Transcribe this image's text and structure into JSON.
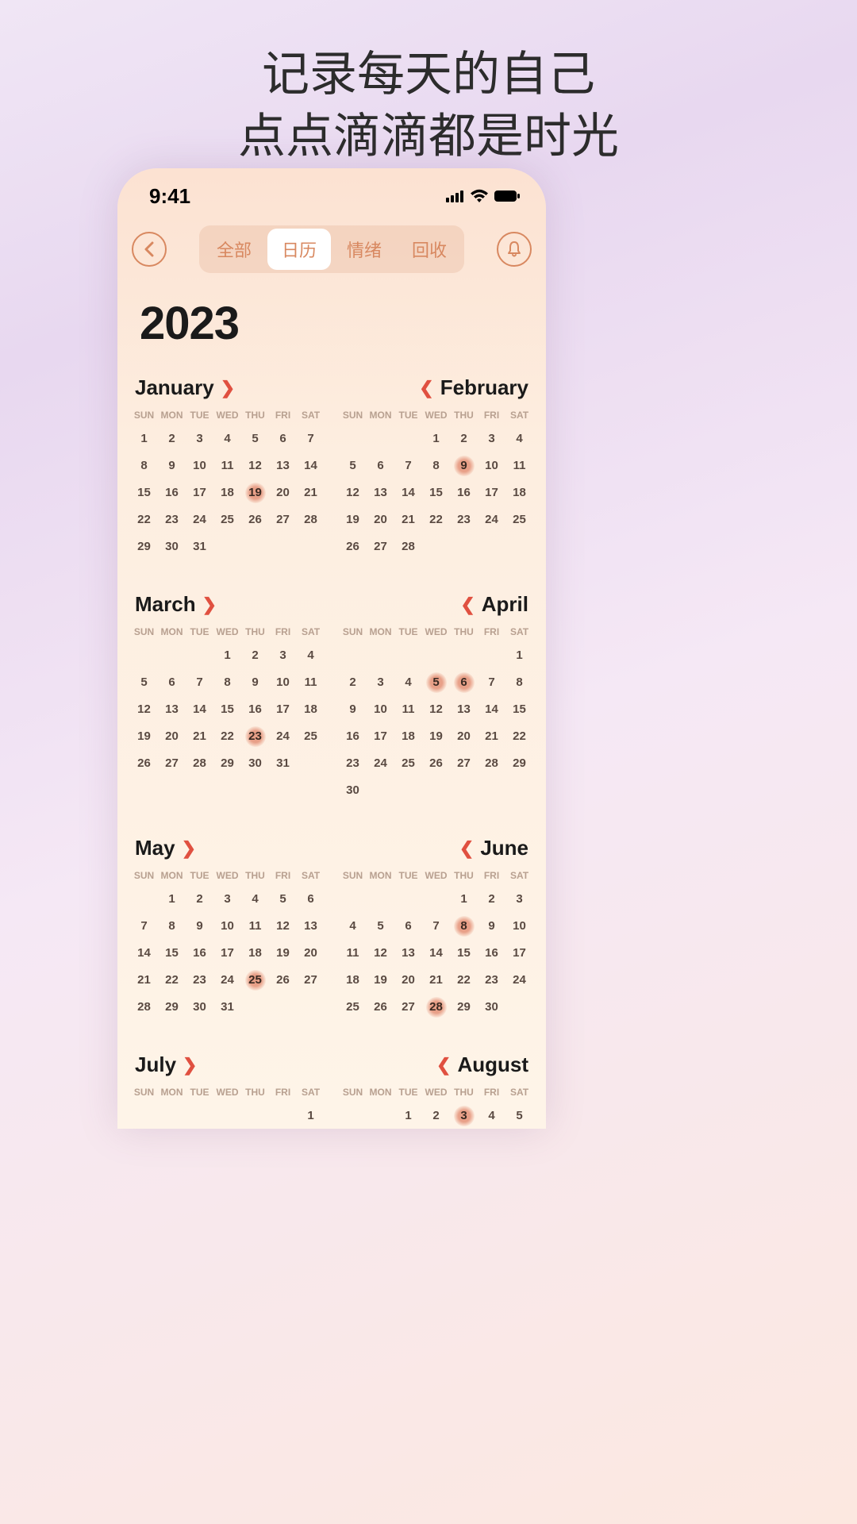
{
  "promo": {
    "line1": "记录每天的自己",
    "line2": "点点滴滴都是时光"
  },
  "status": {
    "time": "9:41"
  },
  "nav": {
    "tabs": [
      {
        "label": "全部",
        "active": false
      },
      {
        "label": "日历",
        "active": true
      },
      {
        "label": "情绪",
        "active": false
      },
      {
        "label": "回收",
        "active": false
      }
    ]
  },
  "year": "2023",
  "weekdays": [
    "SUN",
    "MON",
    "TUE",
    "WED",
    "THU",
    "FRI",
    "SAT"
  ],
  "months": [
    {
      "name": "January",
      "align": "left",
      "startDay": 0,
      "numDays": 31,
      "marked": [
        19
      ]
    },
    {
      "name": "February",
      "align": "right",
      "startDay": 3,
      "numDays": 28,
      "marked": [
        9
      ]
    },
    {
      "name": "March",
      "align": "left",
      "startDay": 3,
      "numDays": 31,
      "marked": [
        23
      ]
    },
    {
      "name": "April",
      "align": "right",
      "startDay": 6,
      "numDays": 30,
      "marked": [
        5,
        6
      ]
    },
    {
      "name": "May",
      "align": "left",
      "startDay": 1,
      "numDays": 31,
      "marked": [
        25
      ]
    },
    {
      "name": "June",
      "align": "right",
      "startDay": 4,
      "numDays": 30,
      "marked": [
        8,
        28
      ]
    },
    {
      "name": "July",
      "align": "left",
      "startDay": 6,
      "numDays": 31,
      "marked": []
    },
    {
      "name": "August",
      "align": "right",
      "startDay": 2,
      "numDays": 31,
      "marked": [
        3
      ]
    }
  ],
  "visibleRows": {
    "6": 1,
    "7": 1
  }
}
